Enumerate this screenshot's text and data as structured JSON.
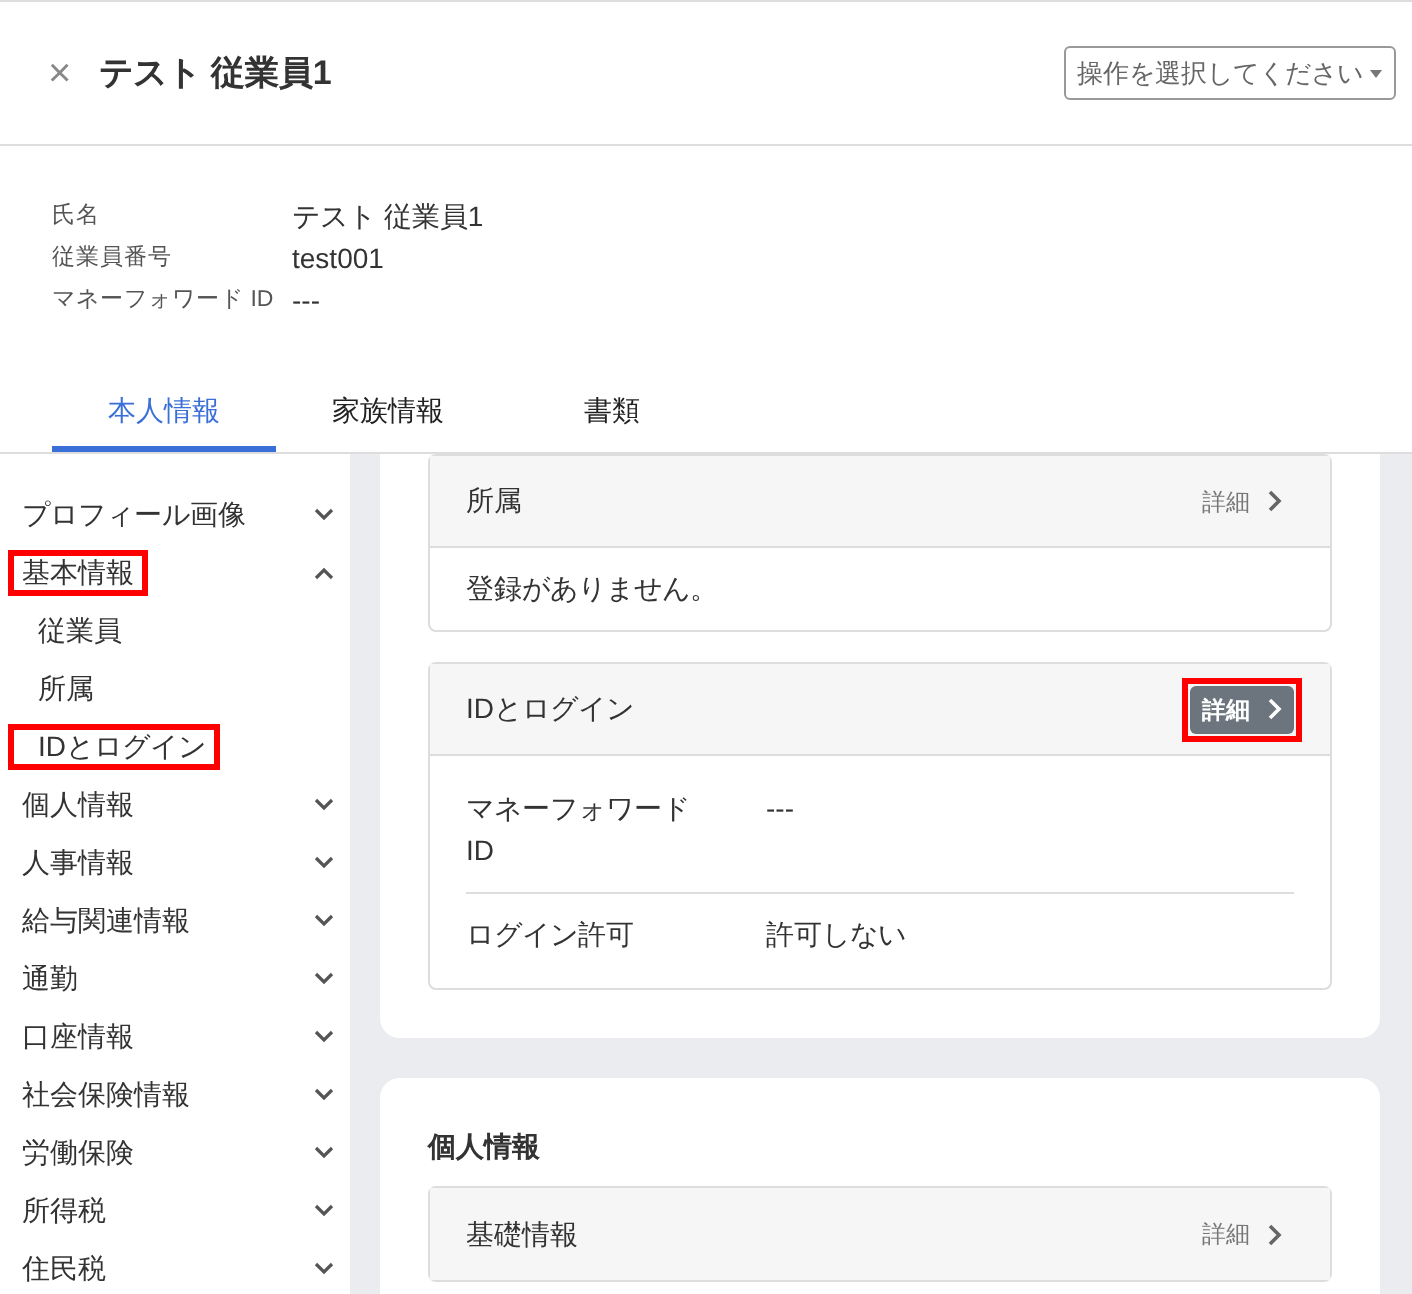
{
  "header": {
    "close_icon_label": "×",
    "title": "テスト 従業員1",
    "action_select": "操作を選択してください"
  },
  "profile": [
    {
      "label": "氏名",
      "value": "テスト 従業員1"
    },
    {
      "label": "従業員番号",
      "value": "test001"
    },
    {
      "label": "マネーフォワード ID",
      "value": "---"
    }
  ],
  "tabs": [
    {
      "label": "本人情報",
      "selected": true
    },
    {
      "label": "家族情報",
      "selected": false
    },
    {
      "label": "書類",
      "selected": false
    }
  ],
  "sidebar": {
    "items": [
      {
        "label": "プロフィール画像",
        "expanded": false,
        "highlighted": false
      },
      {
        "label": "基本情報",
        "expanded": true,
        "highlighted": true,
        "children": [
          {
            "label": "従業員",
            "highlighted": false
          },
          {
            "label": "所属",
            "highlighted": false
          },
          {
            "label": "IDとログイン",
            "highlighted": true
          }
        ]
      },
      {
        "label": "個人情報",
        "expanded": false,
        "highlighted": false
      },
      {
        "label": "人事情報",
        "expanded": false,
        "highlighted": false
      },
      {
        "label": "給与関連情報",
        "expanded": false,
        "highlighted": false
      },
      {
        "label": "通勤",
        "expanded": false,
        "highlighted": false
      },
      {
        "label": "口座情報",
        "expanded": false,
        "highlighted": false
      },
      {
        "label": "社会保険情報",
        "expanded": false,
        "highlighted": false
      },
      {
        "label": "労働保険",
        "expanded": false,
        "highlighted": false
      },
      {
        "label": "所得税",
        "expanded": false,
        "highlighted": false
      },
      {
        "label": "住民税",
        "expanded": false,
        "highlighted": false
      }
    ]
  },
  "sections": [
    {
      "cards": [
        {
          "title": "所属",
          "detail": {
            "label": "詳細",
            "emphasized": false,
            "highlighted": false
          },
          "empty_text": "登録がありません。"
        },
        {
          "title": "IDとログイン",
          "detail": {
            "label": "詳細",
            "emphasized": true,
            "highlighted": true
          },
          "rows": [
            {
              "label": "マネーフォワード ID",
              "value": "---"
            },
            {
              "label": "ログイン許可",
              "value": "許可しない"
            }
          ]
        }
      ]
    },
    {
      "title": "個人情報",
      "cards": [
        {
          "title": "基礎情報",
          "detail": {
            "label": "詳細",
            "emphasized": false,
            "highlighted": false
          }
        }
      ]
    }
  ]
}
